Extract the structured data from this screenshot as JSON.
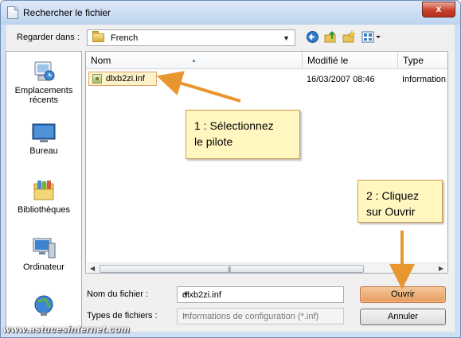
{
  "window": {
    "title": "Rechercher le fichier",
    "close_label": "x"
  },
  "lookin": {
    "label": "Regarder dans :",
    "value": "French"
  },
  "places": [
    {
      "label": "Emplacements récents",
      "icon": "recent-places-icon"
    },
    {
      "label": "Bureau",
      "icon": "desktop-icon"
    },
    {
      "label": "Bibliothèques",
      "icon": "libraries-icon"
    },
    {
      "label": "Ordinateur",
      "icon": "computer-icon"
    },
    {
      "label": "",
      "icon": "network-icon"
    }
  ],
  "filelist": {
    "columns": [
      "Nom",
      "Modifié le",
      "Type"
    ],
    "rows": [
      {
        "name": "dlxb2zi.inf",
        "modified": "16/03/2007 08:46",
        "type": "Information"
      }
    ]
  },
  "filename": {
    "label": "Nom du fichier :",
    "value": "dlxb2zi.inf"
  },
  "filetype": {
    "label": "Types de fichiers :",
    "value": "Informations de configuration (*.inf)"
  },
  "buttons": {
    "open": "Ouvrir",
    "cancel": "Annuler"
  },
  "callouts": {
    "step1_line1": "1 : Sélectionnez",
    "step1_line2": "le pilote",
    "step2_line1": "2 : Cliquez",
    "step2_line2": "sur Ouvrir"
  },
  "watermark": "www.astucesinternet.com",
  "colors": {
    "arrow": "#e8962f",
    "callout_bg": "#fff6c0",
    "selection_bg": "#fdf1c8"
  }
}
